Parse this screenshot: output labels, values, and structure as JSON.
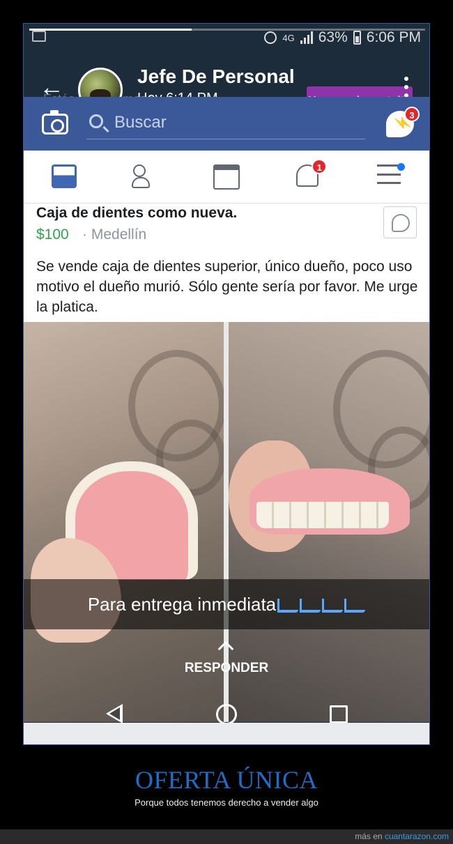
{
  "statusbar": {
    "network": "4G",
    "battery": "63%",
    "clock": "6:06 PM"
  },
  "story": {
    "progress": 0.41,
    "author": "Jefe De Personal",
    "time": "Hoy 6:14 PM",
    "faded_note": "Estás usando modo",
    "free_mode_button": "Usar modo gratuito",
    "caption": "Para entrega inmediata",
    "reply_label": "RESPONDER"
  },
  "facebook": {
    "search_placeholder": "Buscar",
    "messenger_badge": "3",
    "notifications_badge": "1",
    "brand_color": "#3b5998"
  },
  "post": {
    "title": "Caja de dientes como nueva.",
    "price": "$100",
    "separator": "·",
    "location": "Medellín",
    "description": "Se vende caja de dientes superior, único dueño, poco uso motivo el dueño murió. Sólo gente sería por favor. Me urge la platica."
  },
  "meme": {
    "title": "OFERTA ÚNICA",
    "subtitle": "Porque todos tenemos derecho a vender algo",
    "footer_prefix": "más en",
    "footer_link": "cuantarazon.com"
  }
}
